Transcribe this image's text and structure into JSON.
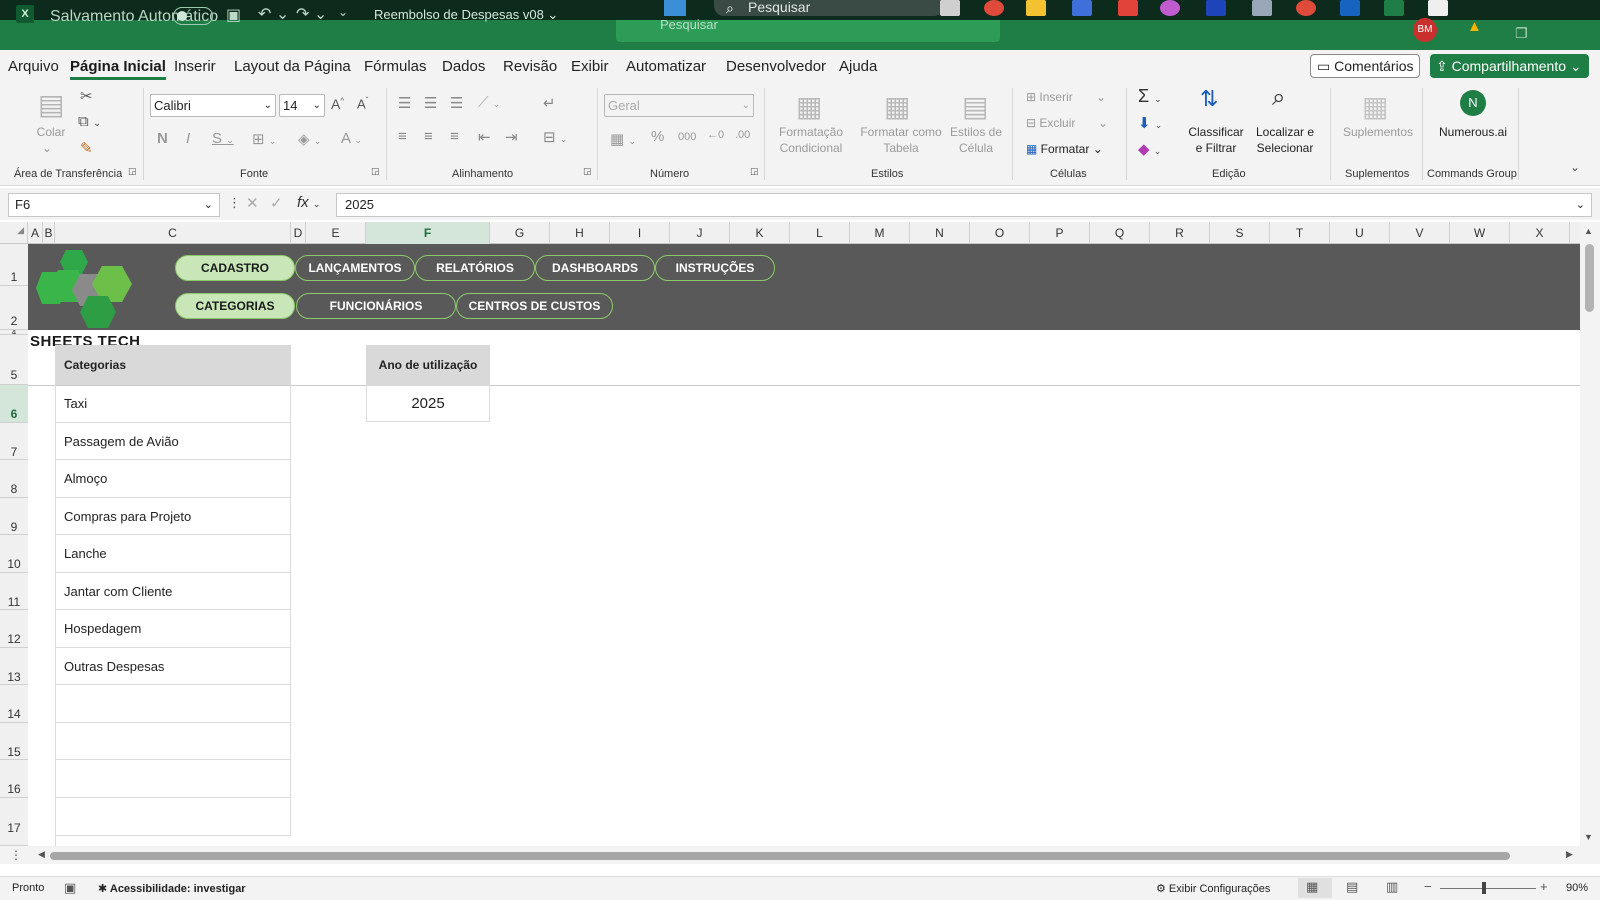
{
  "taskbar": {
    "search_placeholder": "Pesquisar"
  },
  "titlebar": {
    "autosave_label": "Salvamento Automático",
    "doc_title": "Reembolso de Despesas v08 ⌄",
    "search_placeholder": "Pesquisar",
    "avatar": "BM"
  },
  "tabs": [
    "Arquivo",
    "Página Inicial",
    "Inserir",
    "Layout da Página",
    "Fórmulas",
    "Dados",
    "Revisão",
    "Exibir",
    "Automatizar",
    "Desenvolvedor",
    "Ajuda"
  ],
  "header_buttons": {
    "comments": "Comentários",
    "share": "Compartilhamento ⌄"
  },
  "ribbon": {
    "clipboard": {
      "label": "Área de Transferência",
      "paste": "Colar"
    },
    "font": {
      "label": "Fonte",
      "name": "Calibri",
      "size": "14"
    },
    "alignment": {
      "label": "Alinhamento"
    },
    "number": {
      "label": "Número",
      "format": "Geral"
    },
    "styles": {
      "label": "Estilos",
      "cond_format": "Formatação Condicional",
      "table_format": "Formatar como Tabela",
      "cell_styles": "Estilos de Célula"
    },
    "cells": {
      "label": "Células",
      "insert": "Inserir",
      "delete": "Excluir",
      "format": "Formatar"
    },
    "editing": {
      "label": "Edição",
      "sort_filter": "Classificar e Filtrar",
      "find_select": "Localizar e Selecionar"
    },
    "addins": {
      "label": "Suplementos",
      "addins": "Suplementos"
    },
    "commands": {
      "label": "Commands Group",
      "numerous": "Numerous.ai"
    }
  },
  "formula_bar": {
    "name_box": "F6",
    "fx": "fx",
    "value": "2025"
  },
  "columns": [
    "A",
    "B",
    "C",
    "D",
    "E",
    "F",
    "G",
    "H",
    "I",
    "J",
    "K",
    "L",
    "M",
    "N",
    "O",
    "P",
    "Q",
    "R",
    "S",
    "T",
    "U",
    "V",
    "W",
    "X"
  ],
  "rows": [
    "1",
    "2",
    "4",
    "5",
    "6",
    "7",
    "8",
    "9",
    "10",
    "11",
    "12",
    "13",
    "14",
    "15",
    "16",
    "17"
  ],
  "nav": {
    "row1": [
      "CADASTRO",
      "LANÇAMENTOS",
      "RELATÓRIOS",
      "DASHBOARDS",
      "INSTRUÇÕES"
    ],
    "row2": [
      "CATEGORIAS",
      "FUNCIONÁRIOS",
      "CENTROS DE CUSTOS"
    ],
    "brand": "SHEETS TECH"
  },
  "sheet": {
    "categories_header": "Categorias",
    "categories": [
      "Taxi",
      "Passagem de Avião",
      "Almoço",
      "Compras para Projeto",
      "Lanche",
      "Jantar com Cliente",
      "Hospedagem",
      "Outras Despesas"
    ],
    "year_header": "Ano de utilização",
    "year_value": "2025"
  },
  "status": {
    "ready": "Pronto",
    "accessibility": "Acessibilidade: investigar",
    "display_settings": "Exibir Configurações",
    "zoom": "90%"
  },
  "colors": {
    "excel_green": "#1e7e45",
    "nav_band": "#595959",
    "pill_active": "#c8e6b8",
    "pill_border": "#8dc96a",
    "logo_green": "#39b54a"
  }
}
